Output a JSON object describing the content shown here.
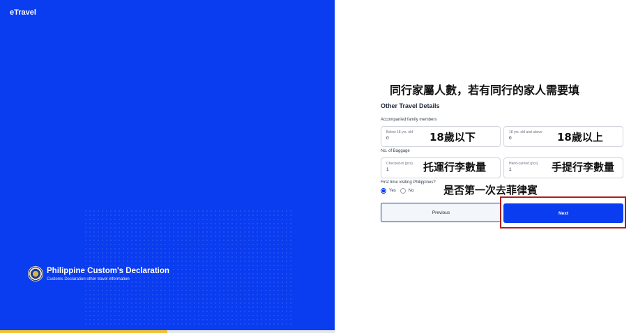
{
  "brand": {
    "logo_text": "eTravel",
    "title": "Philippine Custom's Declaration",
    "subtitle": "Customs Declaration other travel information"
  },
  "progress": {
    "fraction": 0.5
  },
  "annotations": {
    "top": "同行家屬人數，若有同行的家人需要填",
    "below18": "18歲以下",
    "above18": "18歲以上",
    "checked_in": "托運行李數量",
    "hand_carried": "手提行李數量",
    "first_time": "是否第一次去菲律賓"
  },
  "form": {
    "heading": "Other Travel Details",
    "family_label": "Accompanied family members",
    "below18": {
      "label": "Below 18 yrs. old",
      "value": "0"
    },
    "above18": {
      "label": "18 yrs. old and above",
      "value": "0"
    },
    "baggage_label": "No. of Baggage",
    "checked_in": {
      "label": "Checked-in (pcs)",
      "value": "1"
    },
    "hand_carried": {
      "label": "Hand-carried (pcs)",
      "value": "1"
    },
    "first_visit_label": "First time visiting Philippines?",
    "yes_label": "Yes",
    "no_label": "No",
    "selected": "Yes"
  },
  "buttons": {
    "previous": "Previous",
    "next": "Next"
  },
  "colors": {
    "primary": "#0a3cf0",
    "progress": "#f2c230",
    "highlight": "#b01e1e"
  }
}
